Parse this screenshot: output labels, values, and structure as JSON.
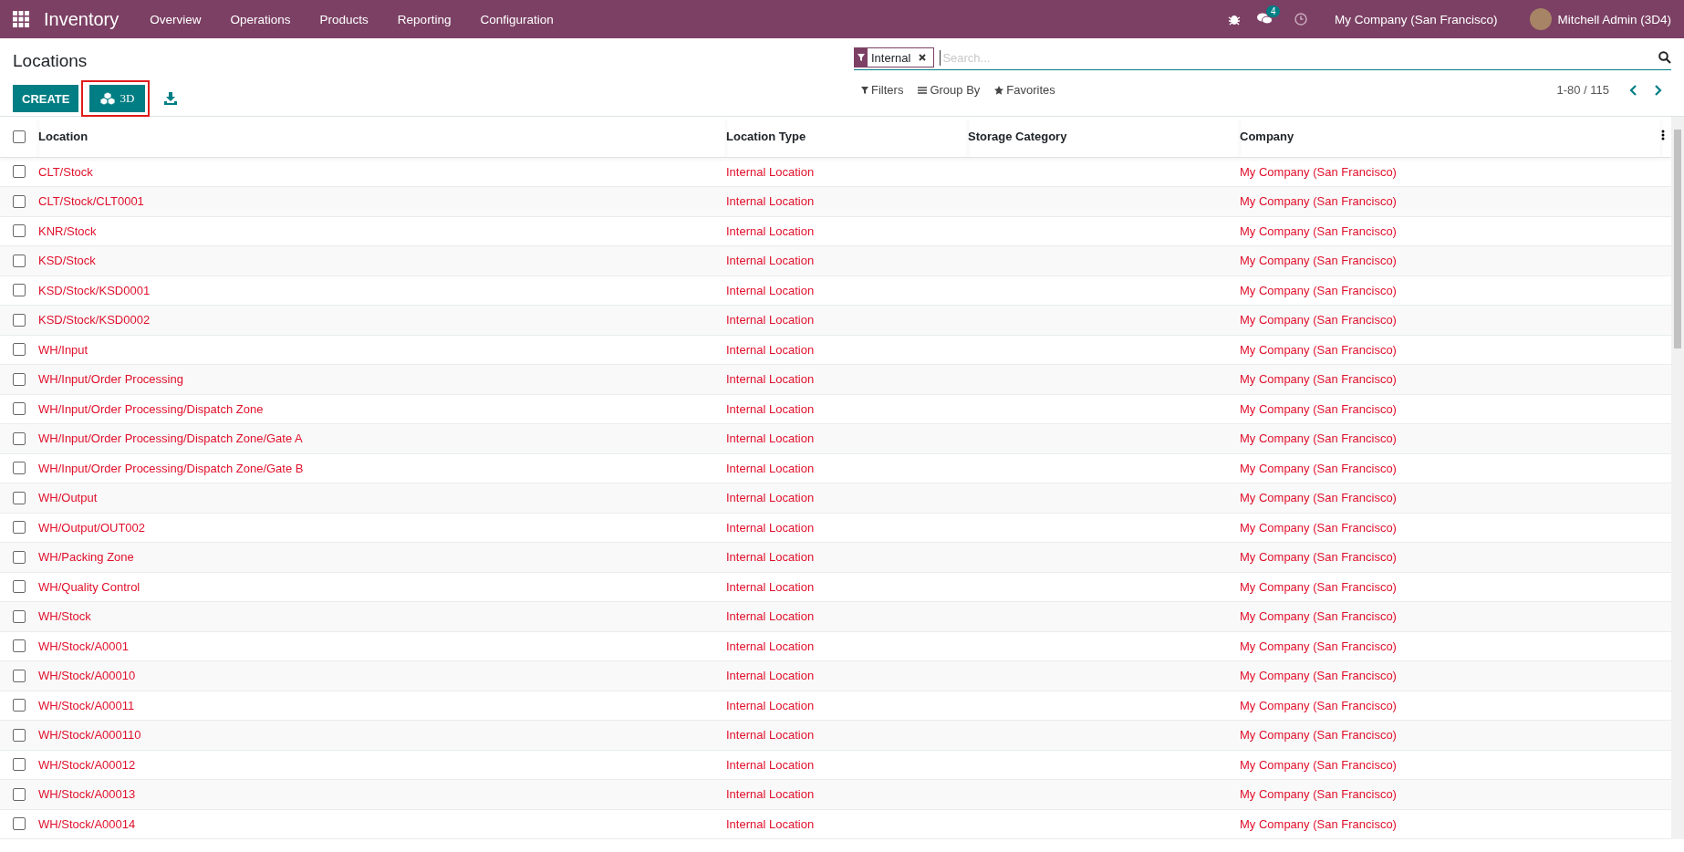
{
  "navbar": {
    "app_name": "Inventory",
    "menu": [
      "Overview",
      "Operations",
      "Products",
      "Reporting",
      "Configuration"
    ],
    "messages_badge": "4",
    "company": "My Company (San Francisco)",
    "user": "Mitchell Admin (3D4)"
  },
  "control_panel": {
    "title": "Locations",
    "create_button": "CREATE",
    "view_3d_button": {
      "label": "3D",
      "highlighted": true
    },
    "search": {
      "facet": "Internal",
      "placeholder": "Search..."
    },
    "filters": "Filters",
    "group_by": "Group By",
    "favorites": "Favorites",
    "pager": "1-80 / 115"
  },
  "table": {
    "select_all_checked": false,
    "columns": [
      "Location",
      "Location Type",
      "Storage Category",
      "Company"
    ],
    "rows": [
      {
        "checked": false,
        "location": "CLT/Stock",
        "type": "Internal Location",
        "company": "My Company (San Francisco)"
      },
      {
        "checked": false,
        "location": "CLT/Stock/CLT0001",
        "type": "Internal Location",
        "company": "My Company (San Francisco)"
      },
      {
        "checked": false,
        "location": "KNR/Stock",
        "type": "Internal Location",
        "company": "My Company (San Francisco)"
      },
      {
        "checked": false,
        "location": "KSD/Stock",
        "type": "Internal Location",
        "company": "My Company (San Francisco)"
      },
      {
        "checked": false,
        "location": "KSD/Stock/KSD0001",
        "type": "Internal Location",
        "company": "My Company (San Francisco)"
      },
      {
        "checked": false,
        "location": "KSD/Stock/KSD0002",
        "type": "Internal Location",
        "company": "My Company (San Francisco)"
      },
      {
        "checked": false,
        "location": "WH/Input",
        "type": "Internal Location",
        "company": "My Company (San Francisco)"
      },
      {
        "checked": false,
        "location": "WH/Input/Order Processing",
        "type": "Internal Location",
        "company": "My Company (San Francisco)"
      },
      {
        "checked": false,
        "location": "WH/Input/Order Processing/Dispatch Zone",
        "type": "Internal Location",
        "company": "My Company (San Francisco)"
      },
      {
        "checked": false,
        "location": "WH/Input/Order Processing/Dispatch Zone/Gate A",
        "type": "Internal Location",
        "company": "My Company (San Francisco)"
      },
      {
        "checked": false,
        "location": "WH/Input/Order Processing/Dispatch Zone/Gate B",
        "type": "Internal Location",
        "company": "My Company (San Francisco)"
      },
      {
        "checked": false,
        "location": "WH/Output",
        "type": "Internal Location",
        "company": "My Company (San Francisco)"
      },
      {
        "checked": false,
        "location": "WH/Output/OUT002",
        "type": "Internal Location",
        "company": "My Company (San Francisco)"
      },
      {
        "checked": false,
        "location": "WH/Packing Zone",
        "type": "Internal Location",
        "company": "My Company (San Francisco)"
      },
      {
        "checked": false,
        "location": "WH/Quality Control",
        "type": "Internal Location",
        "company": "My Company (San Francisco)"
      },
      {
        "checked": false,
        "location": "WH/Stock",
        "type": "Internal Location",
        "company": "My Company (San Francisco)"
      },
      {
        "checked": false,
        "location": "WH/Stock/A0001",
        "type": "Internal Location",
        "company": "My Company (San Francisco)"
      },
      {
        "checked": false,
        "location": "WH/Stock/A00010",
        "type": "Internal Location",
        "company": "My Company (San Francisco)"
      },
      {
        "checked": false,
        "location": "WH/Stock/A00011",
        "type": "Internal Location",
        "company": "My Company (San Francisco)"
      },
      {
        "checked": false,
        "location": "WH/Stock/A000110",
        "type": "Internal Location",
        "company": "My Company (San Francisco)"
      },
      {
        "checked": false,
        "location": "WH/Stock/A00012",
        "type": "Internal Location",
        "company": "My Company (San Francisco)"
      },
      {
        "checked": false,
        "location": "WH/Stock/A00013",
        "type": "Internal Location",
        "company": "My Company (San Francisco)"
      },
      {
        "checked": false,
        "location": "WH/Stock/A00014",
        "type": "Internal Location",
        "company": "My Company (San Francisco)"
      }
    ]
  }
}
